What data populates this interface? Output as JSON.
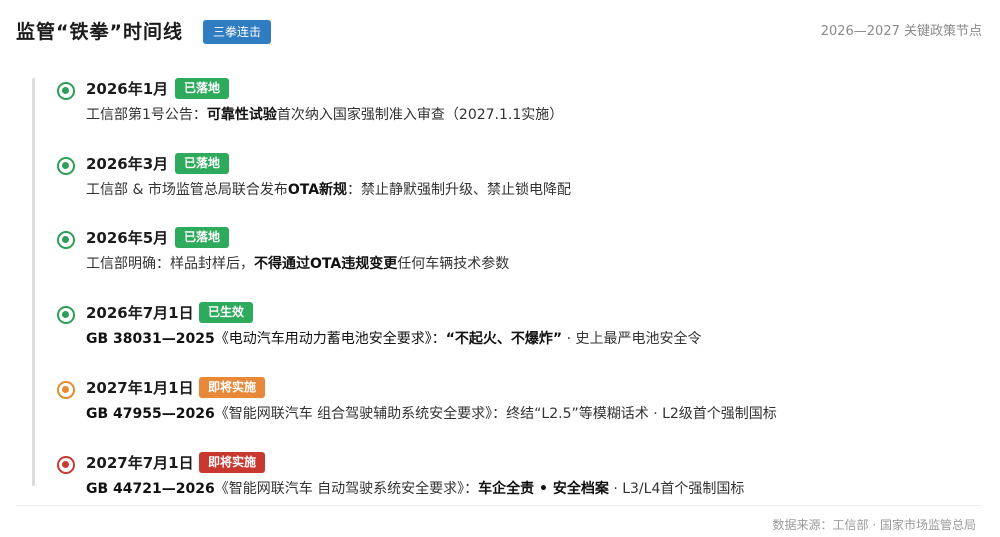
{
  "header": {
    "title": "监管“铁拳”时间线",
    "badge": "三拳连击",
    "range": "2026—2027 关键政策节点"
  },
  "items": [
    {
      "date": "2026年1月",
      "status": "已落地",
      "status_color": "#2eaa5c",
      "desc_pre": "工信部第1号公告：",
      "desc_bold": "可靠性试验",
      "desc_post": "首次纳入国家强制准入审查（2027.1.1实施）"
    },
    {
      "date": "2026年3月",
      "status": "已落地",
      "status_color": "#2eaa5c",
      "desc_pre": "工信部 & 市场监管总局联合发布",
      "desc_bold": "OTA新规",
      "desc_post": "：禁止静默强制升级、禁止锁电降配"
    },
    {
      "date": "2026年5月",
      "status": "已落地",
      "status_color": "#2eaa5c",
      "desc_pre": "工信部明确：样品封样后，",
      "desc_bold": "不得通过OTA违规变更",
      "desc_post": "任何车辆技术参数"
    },
    {
      "date": "2026年7月1日",
      "status": "已生效",
      "status_color": "#2eaa5c",
      "desc_pre": "GB 38031—2025《电动汽车用动力蓄电池安全要求》：",
      "desc_bold": "“不起火、不爆炸”",
      "desc_post": " · 史上最严电池安全令"
    },
    {
      "date": "2027年1月1日",
      "status": "即将实施",
      "status_color": "#e8893a",
      "desc_pre": "GB 47955—2026《智能网联汽车 组合驾驶辅助系统安全要求》：终结“L2.5”等模糊话术 · L2级首个强制国标",
      "desc_bold": "",
      "desc_post": ""
    },
    {
      "date": "2027年7月1日",
      "status": "即将实施",
      "status_color": "#c9382f",
      "desc_pre": "GB 44721—2026《智能网联汽车 自动驾驶系统安全要求》：",
      "desc_bold": "车企全责 • 安全档案",
      "desc_post": " · L3/L4首个强制国标"
    }
  ],
  "footer": {
    "source": "数据来源：工信部 · 国家市场监管总局"
  }
}
